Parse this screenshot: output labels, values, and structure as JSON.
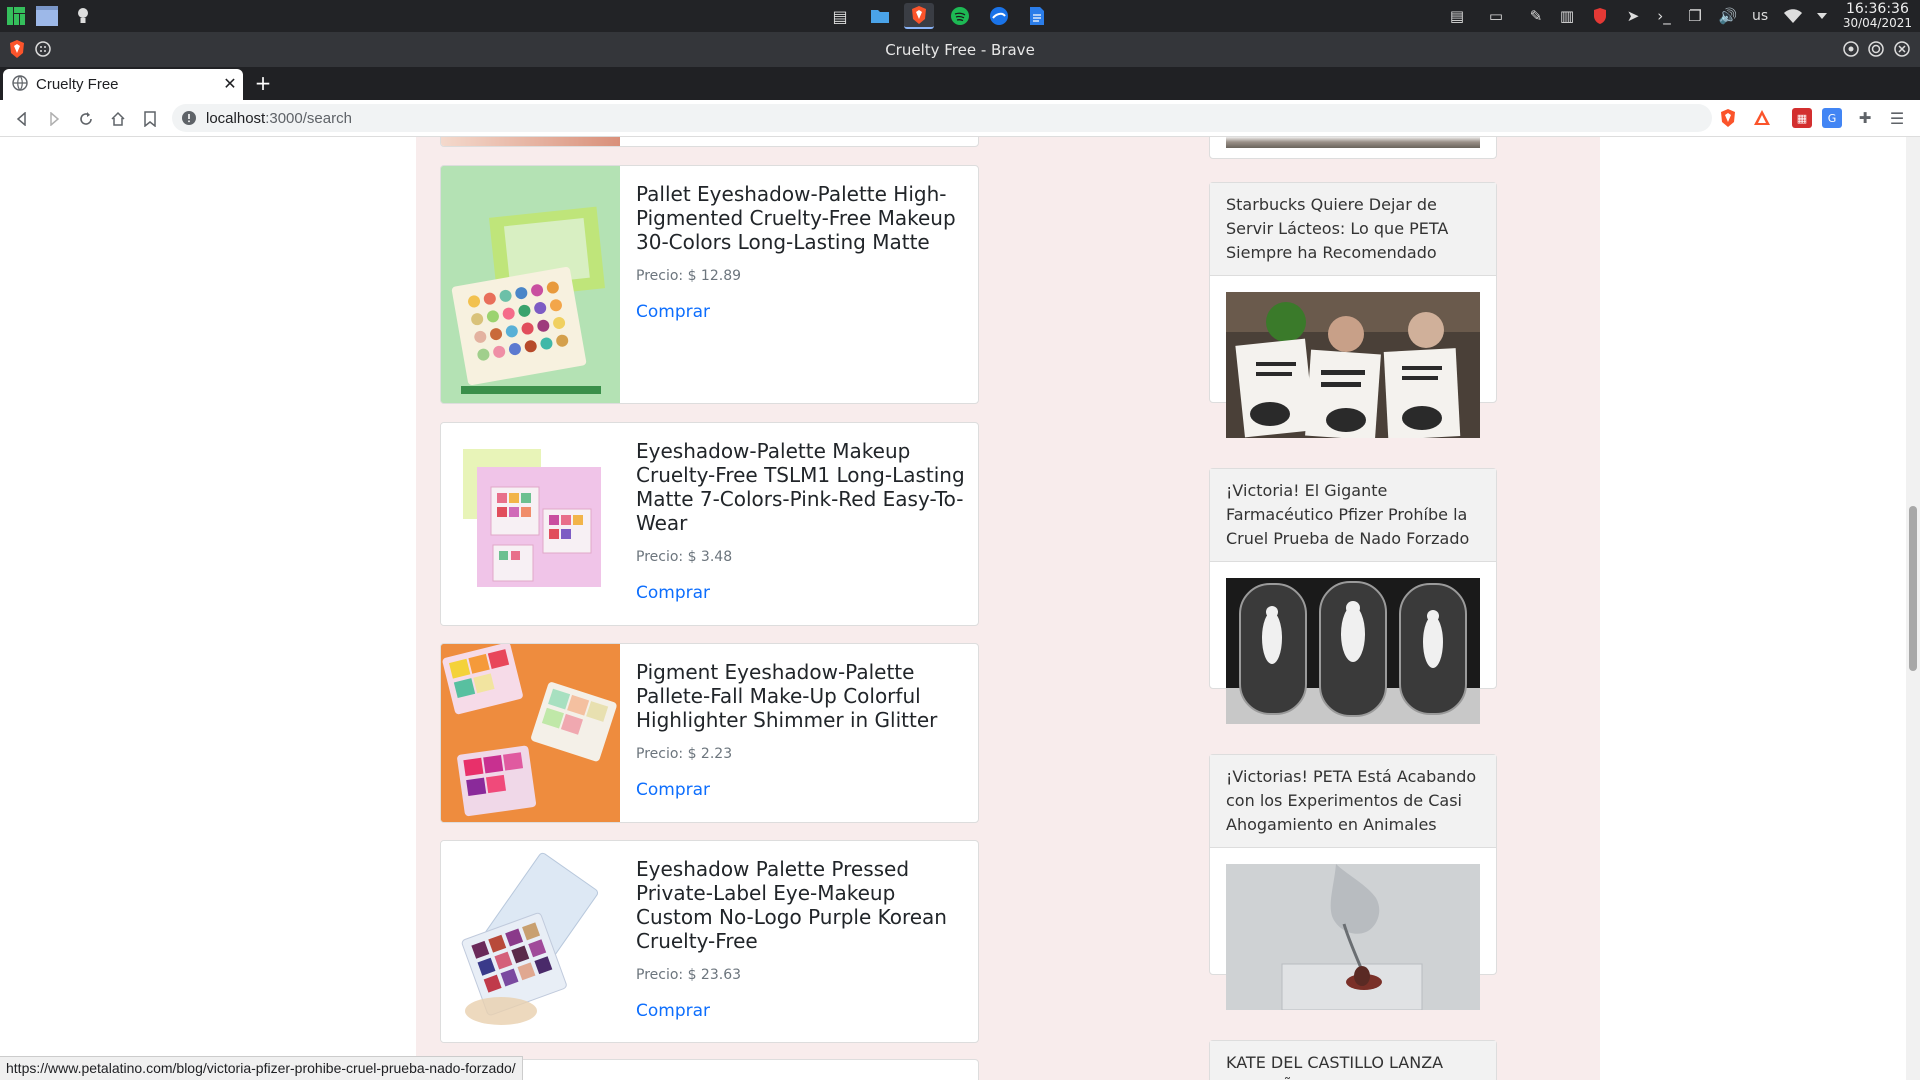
{
  "taskbar": {
    "language": "us",
    "time": "16:36:36",
    "date": "30/04/2021",
    "apps": [
      "notes-icon",
      "files-icon",
      "brave-icon",
      "spotify-icon",
      "thunderbird-icon",
      "docs-icon"
    ]
  },
  "browser": {
    "window_title": "Cruelty Free - Brave",
    "tab_title": "Cruelty Free",
    "url_host": "localhost",
    "url_path": ":3000/search"
  },
  "products": [
    {
      "title": "Pallet Eyeshadow-Palette High-Pigmented Cruelty-Free Makeup 30-Colors Long-Lasting Matte",
      "price": "Precio: $ 12.89",
      "buy": "Comprar"
    },
    {
      "title": "Eyeshadow-Palette Makeup Cruelty-Free TSLM1 Long-Lasting Matte 7-Colors-Pink-Red Easy-To-Wear",
      "price": "Precio: $ 3.48",
      "buy": "Comprar"
    },
    {
      "title": "Pigment Eyeshadow-Palette Pallete-Fall Make-Up Colorful Highlighter Shimmer in Glitter",
      "price": "Precio: $ 2.23",
      "buy": "Comprar"
    },
    {
      "title": "Eyeshadow Palette Pressed Private-Label Eye-Makeup Custom No-Logo Purple Korean Cruelty-Free",
      "price": "Precio: $ 23.63",
      "buy": "Comprar"
    }
  ],
  "news": [
    {
      "title": "Starbucks Quiere Dejar de Servir Lácteos: Lo que PETA Siempre ha Recomendado"
    },
    {
      "title": "¡Victoria! El Gigante Farmacéutico Pfizer Prohíbe la Cruel Prueba de Nado Forzado"
    },
    {
      "title": "¡Victorias! PETA Está Acabando con los Experimentos de Casi Ahogamiento en Animales"
    },
    {
      "title": "KATE DEL CASTILLO LANZA CAMPAÑA ANTIVIOLENCIA"
    }
  ],
  "status_url": "https://www.petalatino.com/blog/victoria-pfizer-prohibe-cruel-prueba-nado-forzado/",
  "colors": {
    "accent": "#0d6efd",
    "page_bg": "#f8ecec"
  }
}
